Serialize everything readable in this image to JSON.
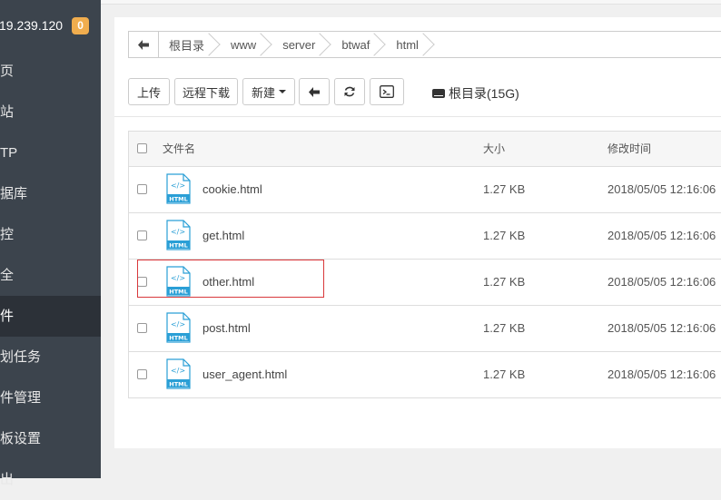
{
  "sidebar": {
    "ip": "19.239.120",
    "badge": "0",
    "items": [
      {
        "label": "页"
      },
      {
        "label": "站"
      },
      {
        "label": "TP"
      },
      {
        "label": "据库"
      },
      {
        "label": "控"
      },
      {
        "label": "全"
      },
      {
        "label": "件",
        "active": true
      },
      {
        "label": "划任务"
      },
      {
        "label": "件管理"
      },
      {
        "label": "板设置"
      },
      {
        "label": "出"
      }
    ]
  },
  "breadcrumb": {
    "items": [
      "根目录",
      "www",
      "server",
      "btwaf",
      "html"
    ]
  },
  "toolbar": {
    "upload_label": "上传",
    "remote_download_label": "远程下载",
    "new_label": "新建",
    "disk_label": "根目录(15G)"
  },
  "table": {
    "headers": {
      "name": "文件名",
      "size": "大小",
      "mtime": "修改时间"
    },
    "rows": [
      {
        "name": "cookie.html",
        "size": "1.27 KB",
        "mtime": "2018/05/05 12:16:06"
      },
      {
        "name": "get.html",
        "size": "1.27 KB",
        "mtime": "2018/05/05 12:16:06"
      },
      {
        "name": "other.html",
        "size": "1.27 KB",
        "mtime": "2018/05/05 12:16:06"
      },
      {
        "name": "post.html",
        "size": "1.27 KB",
        "mtime": "2018/05/05 12:16:06"
      },
      {
        "name": "user_agent.html",
        "size": "1.27 KB",
        "mtime": "2018/05/05 12:16:06"
      }
    ],
    "file_icon_label": "HTML"
  },
  "colors": {
    "sidebar_bg": "#3c444d",
    "sidebar_active": "#2c3138",
    "badge": "#f0ad4e",
    "highlight_border": "#d9383b",
    "file_icon": "#2a9fd6"
  }
}
